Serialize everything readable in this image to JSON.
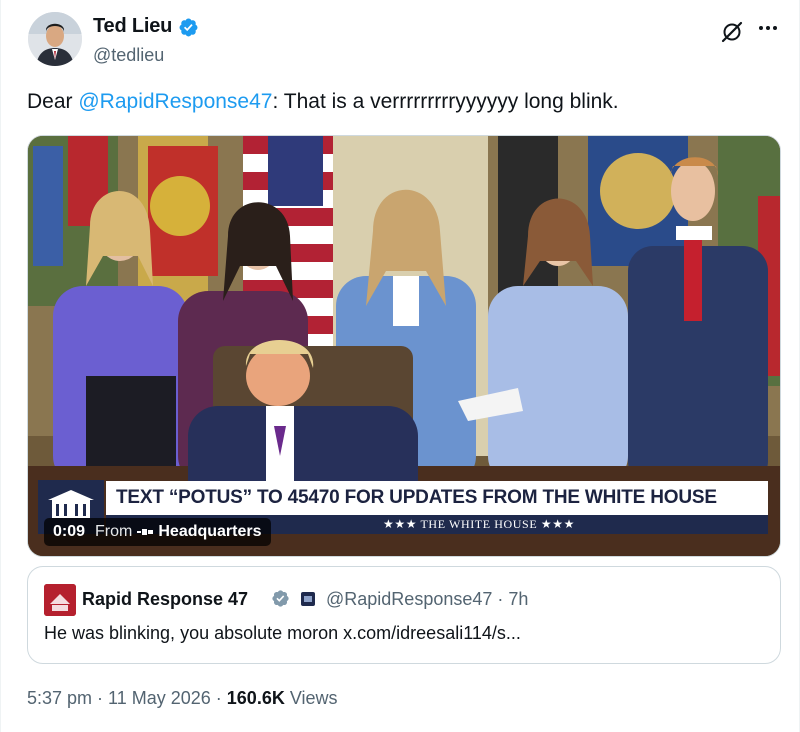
{
  "author": {
    "name": "Ted Lieu",
    "handle": "@tedlieu",
    "verified": true,
    "avatar_icon": "profile-photo"
  },
  "tweet": {
    "text_before": "Dear ",
    "mention": "@RapidResponse47",
    "text_after": ": That is a verrrrrrrrryyyyyy long blink."
  },
  "media": {
    "chyron_main": "TEXT “POTUS” TO 45470 FOR UPDATES FROM THE WHITE HOUSE",
    "chyron_sub": "★★★  THE WHITE HOUSE  ★★★",
    "video_time": "0:09",
    "from_label": "From",
    "source": "Headquarters"
  },
  "quote": {
    "name": "Rapid Response 47",
    "handle_time": "@RapidResponse47 · 7h",
    "text": "He was blinking, you absolute moron x.com/idreesali114/s..."
  },
  "meta": {
    "time_date": "5:37 pm · 11 May 2026 · ",
    "views_count": "160.6K",
    "views_label": " Views"
  },
  "colors": {
    "accent": "#1d9bf0",
    "secondary_text": "#536471",
    "chyron_navy": "#1f2a4d"
  },
  "icons": {
    "verified": "verified-badge-icon",
    "grok": "grok-icon",
    "more": "more-icon",
    "flag": "government-flag-icon"
  }
}
